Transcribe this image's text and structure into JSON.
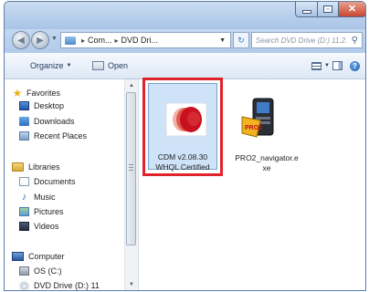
{
  "window": {
    "title_buttons": {
      "minimize": "minimize-icon",
      "maximize": "maximize-icon",
      "close": "close-icon"
    }
  },
  "nav": {
    "breadcrumb": [
      "Com...",
      "DVD Dri..."
    ],
    "search_placeholder": "Search DVD Drive (D:) 11.2..."
  },
  "toolbar": {
    "organize_label": "Organize",
    "open_label": "Open"
  },
  "sidebar": {
    "items": [
      {
        "label": "Favorites",
        "icon": "star-icon"
      },
      {
        "label": "Desktop",
        "icon": "desktop-icon"
      },
      {
        "label": "Downloads",
        "icon": "downloads-icon"
      },
      {
        "label": "Recent Places",
        "icon": "recent-places-icon"
      },
      {
        "label": "Libraries",
        "icon": "libraries-icon"
      },
      {
        "label": "Documents",
        "icon": "documents-icon"
      },
      {
        "label": "Music",
        "icon": "music-icon"
      },
      {
        "label": "Pictures",
        "icon": "pictures-icon"
      },
      {
        "label": "Videos",
        "icon": "videos-icon"
      },
      {
        "label": "Computer",
        "icon": "computer-icon"
      },
      {
        "label": "OS (C:)",
        "icon": "drive-icon"
      },
      {
        "label": "DVD Drive (D:) 11",
        "icon": "dvd-icon"
      }
    ]
  },
  "files": [
    {
      "name_line1": "CDM v2.08.30",
      "name_line2": "WHQL Certified",
      "selected": true,
      "highlight_color": "#e0232b"
    },
    {
      "name_line1": "PRO2_navigator.e",
      "name_line2": "xe",
      "selected": false,
      "badge_text": "PRO2"
    }
  ]
}
